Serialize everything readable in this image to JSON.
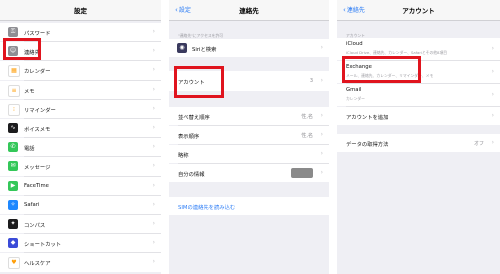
{
  "settings": {
    "title": "設定",
    "items": [
      {
        "label": "パスワード",
        "icon": "key-icon",
        "color": "#8e8e93",
        "glyph": "⚿"
      },
      {
        "label": "連絡先",
        "icon": "contacts-icon",
        "color": "#8e8e93",
        "glyph": "☺"
      },
      {
        "label": "カレンダー",
        "icon": "calendar-icon",
        "color": "#ffffff",
        "glyph": "▦"
      },
      {
        "label": "メモ",
        "icon": "notes-icon",
        "color": "#ffffff",
        "glyph": "≡"
      },
      {
        "label": "リマインダー",
        "icon": "reminders-icon",
        "color": "#ffffff",
        "glyph": "⁝"
      },
      {
        "label": "ボイスメモ",
        "icon": "voice-memo-icon",
        "color": "#1c1c1e",
        "glyph": "∿"
      },
      {
        "label": "電話",
        "icon": "phone-icon",
        "color": "#34c759",
        "glyph": "✆"
      },
      {
        "label": "メッセージ",
        "icon": "messages-icon",
        "color": "#34c759",
        "glyph": "✉"
      },
      {
        "label": "FaceTime",
        "icon": "facetime-icon",
        "color": "#34c759",
        "glyph": "▶"
      },
      {
        "label": "Safari",
        "icon": "safari-icon",
        "color": "#1e88ff",
        "glyph": "✧"
      },
      {
        "label": "コンパス",
        "icon": "compass-icon",
        "color": "#1c1c1e",
        "glyph": "✦"
      },
      {
        "label": "ショートカット",
        "icon": "shortcuts-icon",
        "color": "#3b4bd8",
        "glyph": "◆"
      },
      {
        "label": "ヘルスケア",
        "icon": "health-icon",
        "color": "#ffffff",
        "glyph": "♥"
      }
    ]
  },
  "contacts": {
    "back": "設定",
    "title": "連絡先",
    "header_note": "\"連絡先\"にアクセスを許可",
    "siri_label": "Siriと検索",
    "accounts_label": "アカウント",
    "accounts_value": "3",
    "sort_label": "並べ替え順序",
    "sort_value": "性,名",
    "display_label": "表示順序",
    "display_value": "性,名",
    "short_name_label": "略称",
    "my_info_label": "自分の情報",
    "import_sim": "SIMの連絡先を読み込む"
  },
  "accounts": {
    "back": "連絡先",
    "title": "アカウント",
    "header_note": "アカウント",
    "icloud_label": "iCloud",
    "icloud_sub": "iCloud Drive、連絡先、カレンダー、Safariとその他8項目",
    "exchange_label": "Exchange",
    "exchange_sub": "メール、連絡先、カレンダー、リマインダー、メモ",
    "gmail_label": "Gmail",
    "gmail_sub": "カレンダー",
    "add_account": "アカウントを追加",
    "fetch_label": "データの取得方法",
    "fetch_value": "オフ"
  },
  "colors": {
    "highlight": "#e0141e",
    "link": "#2b7cf6"
  }
}
